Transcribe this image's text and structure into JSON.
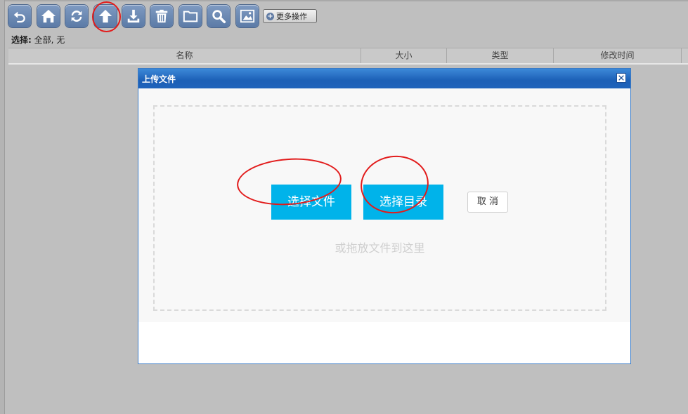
{
  "toolbar": {
    "buttons": [
      {
        "icon": "back-arrow-icon"
      },
      {
        "icon": "home-icon"
      },
      {
        "icon": "refresh-icon"
      },
      {
        "icon": "upload-icon"
      },
      {
        "icon": "download-icon"
      },
      {
        "icon": "trash-icon"
      },
      {
        "icon": "folder-icon"
      },
      {
        "icon": "search-icon"
      },
      {
        "icon": "image-icon"
      }
    ],
    "more_label": "更多操作",
    "accent_color": "#5b7aa6"
  },
  "selection": {
    "label": "选择:",
    "value": "全部, 无"
  },
  "table": {
    "columns": [
      "名称",
      "大小",
      "类型",
      "修改时间"
    ]
  },
  "dialog": {
    "title": "上传文件",
    "choose_file_label": "选择文件",
    "choose_dir_label": "选择目录",
    "cancel_label": "取 消",
    "drop_hint": "或拖放文件到这里",
    "button_color": "#00b3ea"
  },
  "annotations": {
    "circle_color": "#e21b1b"
  }
}
